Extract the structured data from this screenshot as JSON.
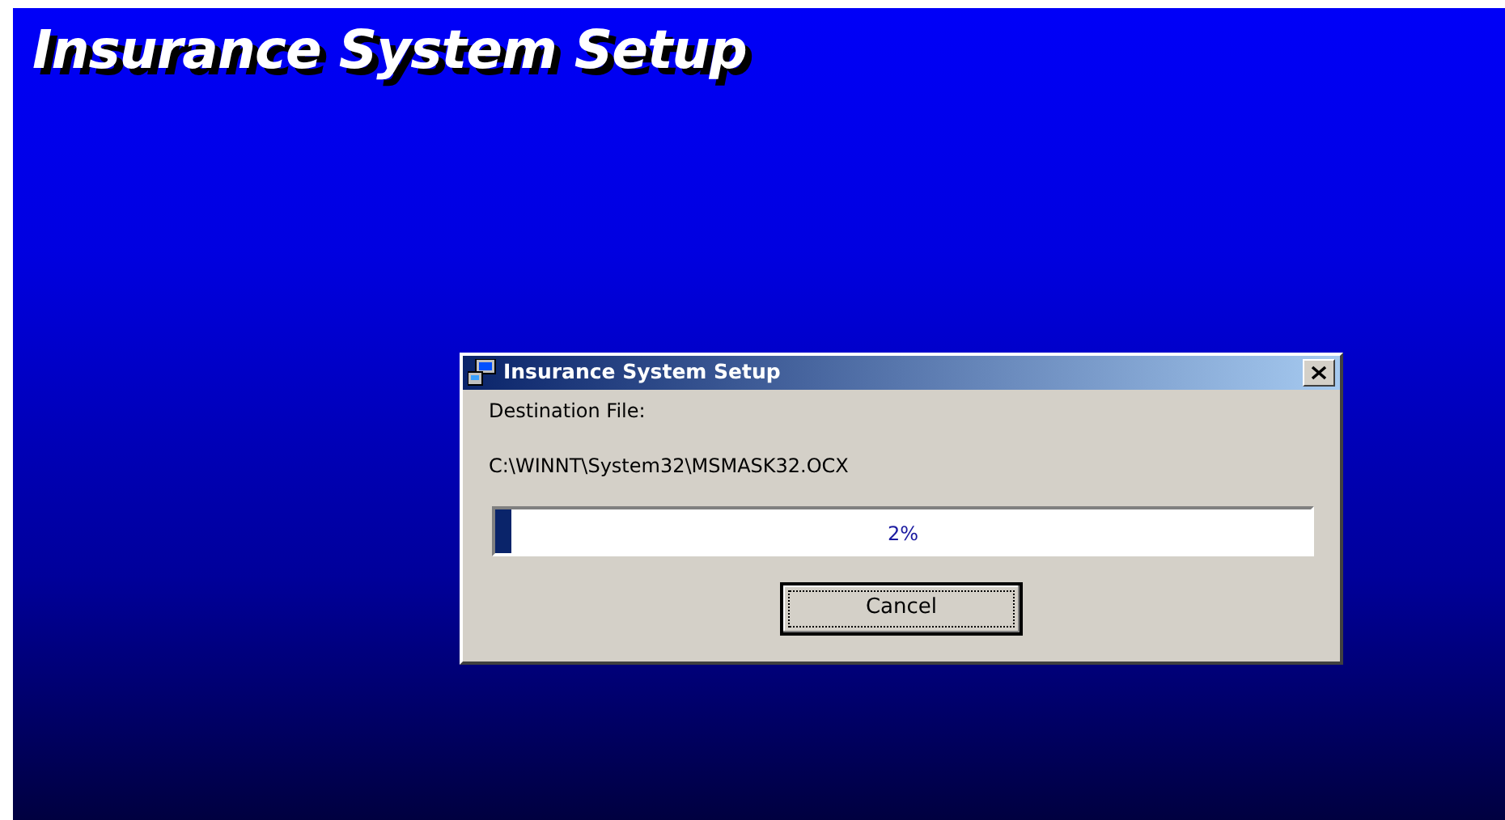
{
  "banner": {
    "title": "Insurance System Setup"
  },
  "dialog": {
    "title": "Insurance System Setup",
    "label": "Destination File:",
    "file_path": "C:\\WINNT\\System32\\MSMASK32.OCX",
    "progress": {
      "level": 0.02,
      "reading": "2%"
    },
    "buttons": [
      {
        "label": "Cancel",
        "default": true
      }
    ]
  }
}
